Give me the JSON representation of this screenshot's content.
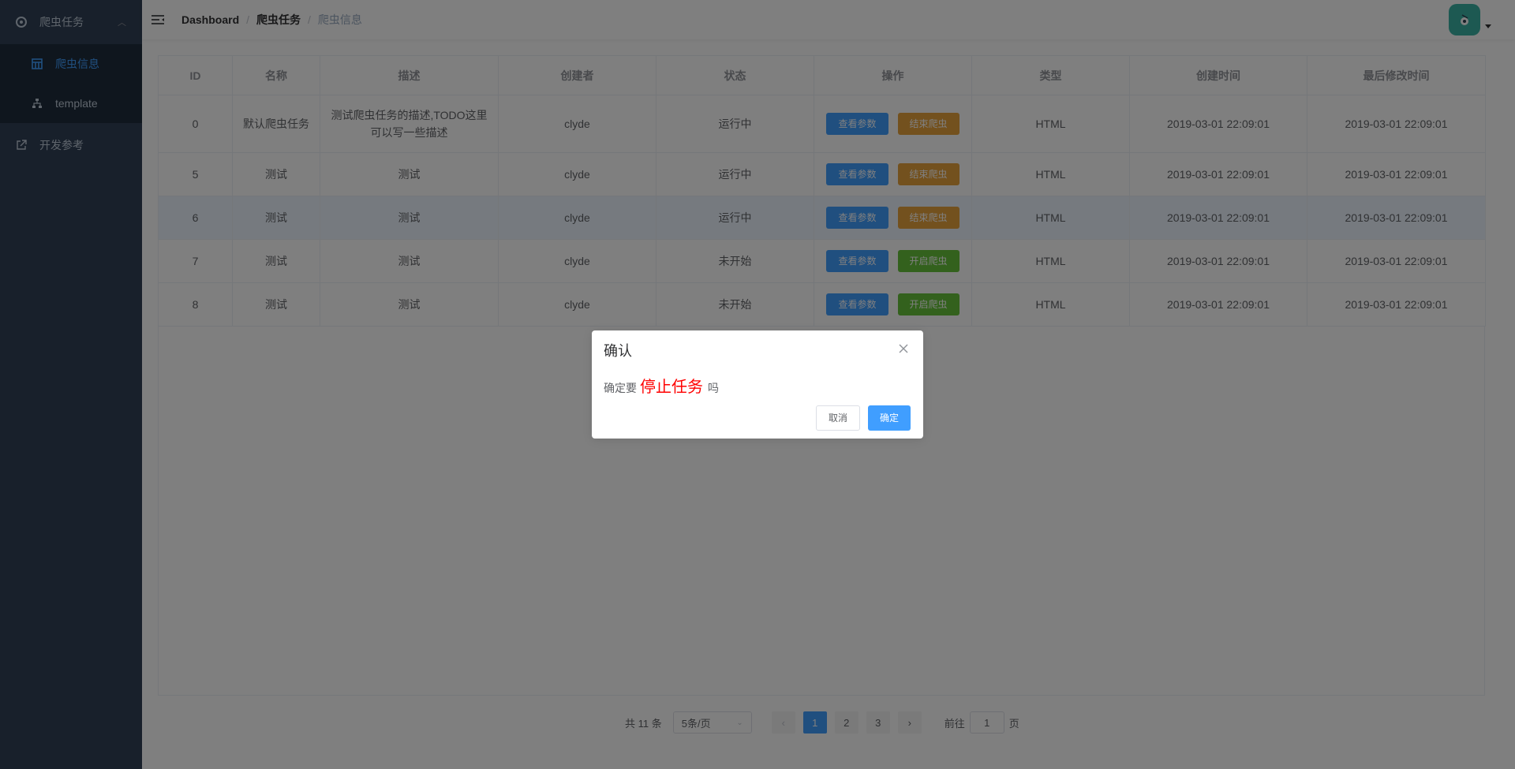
{
  "sidebar": {
    "group_label": "爬虫任务",
    "items": [
      {
        "label": "爬虫信息"
      },
      {
        "label": "template"
      }
    ],
    "external_label": "开发参考"
  },
  "navbar": {
    "breadcrumb": [
      "Dashboard",
      "爬虫任务",
      "爬虫信息"
    ]
  },
  "table": {
    "headers": [
      "ID",
      "名称",
      "描述",
      "创建者",
      "状态",
      "操作",
      "类型",
      "创建时间",
      "最后修改时间"
    ],
    "rows": [
      {
        "id": "0",
        "name": "默认爬虫任务",
        "desc_line1": "测试爬虫任务的描述,TODO这里",
        "desc_line2": "可以写一些描述",
        "creator": "clyde",
        "status": "运行中",
        "btn1": "查看参数",
        "btn2": "结束爬虫",
        "type": "HTML",
        "created": "2019-03-01 22:09:01",
        "modified": "2019-03-01 22:09:01"
      },
      {
        "id": "5",
        "name": "测试",
        "desc": "测试",
        "creator": "clyde",
        "status": "运行中",
        "btn1": "查看参数",
        "btn2": "结束爬虫",
        "type": "HTML",
        "created": "2019-03-01 22:09:01",
        "modified": "2019-03-01 22:09:01"
      },
      {
        "id": "6",
        "name": "测试",
        "desc": "测试",
        "creator": "clyde",
        "status": "运行中",
        "btn1": "查看参数",
        "btn2": "结束爬虫",
        "type": "HTML",
        "created": "2019-03-01 22:09:01",
        "modified": "2019-03-01 22:09:01"
      },
      {
        "id": "7",
        "name": "测试",
        "desc": "测试",
        "creator": "clyde",
        "status": "未开始",
        "btn1": "查看参数",
        "btn2": "开启爬虫",
        "type": "HTML",
        "created": "2019-03-01 22:09:01",
        "modified": "2019-03-01 22:09:01"
      },
      {
        "id": "8",
        "name": "测试",
        "desc": "测试",
        "creator": "clyde",
        "status": "未开始",
        "btn1": "查看参数",
        "btn2": "开启爬虫",
        "type": "HTML",
        "created": "2019-03-01 22:09:01",
        "modified": "2019-03-01 22:09:01"
      }
    ]
  },
  "pagination": {
    "total": "共 11 条",
    "page_size": "5条/页",
    "pages": [
      "1",
      "2",
      "3"
    ],
    "current_page": "1",
    "goto_prefix": "前往",
    "goto_value": "1",
    "goto_suffix": "页"
  },
  "dialog": {
    "title": "确认",
    "msg_prefix": "确定要",
    "msg_strong": "停止任务",
    "msg_suffix": "吗",
    "cancel_label": "取消",
    "confirm_label": "确定"
  },
  "colors": {
    "sidebar_bg": "#304156",
    "submenu_bg": "#1f2d3d",
    "primary": "#409eff",
    "warning": "#e6a23c",
    "success": "#67c23a",
    "danger_text": "#ff0000"
  },
  "icons": {
    "sidebar_group": "gear-icon",
    "sidebar_item_1": "table-icon",
    "sidebar_item_2": "tree-icon",
    "sidebar_external": "external-link-icon",
    "navbar_toggle": "hamburger-icon",
    "dialog_close": "close-icon"
  }
}
